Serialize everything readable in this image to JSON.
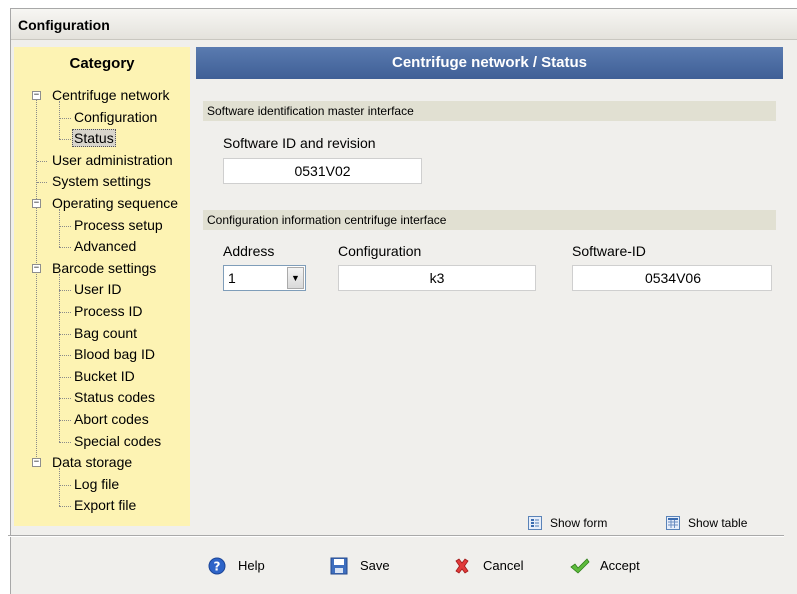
{
  "window": {
    "title": "Configuration"
  },
  "sidebar": {
    "header": "Category",
    "items": [
      {
        "label": "Centrifuge network",
        "level": 0,
        "toggle": "−"
      },
      {
        "label": "Configuration",
        "level": 1
      },
      {
        "label": "Status",
        "level": 1,
        "selected": true
      },
      {
        "label": "User administration",
        "level": 0
      },
      {
        "label": "System settings",
        "level": 0
      },
      {
        "label": "Operating sequence",
        "level": 0,
        "toggle": "−"
      },
      {
        "label": "Process setup",
        "level": 1
      },
      {
        "label": "Advanced",
        "level": 1
      },
      {
        "label": "Barcode settings",
        "level": 0,
        "toggle": "−"
      },
      {
        "label": "User ID",
        "level": 1
      },
      {
        "label": "Process ID",
        "level": 1
      },
      {
        "label": "Bag count",
        "level": 1
      },
      {
        "label": "Blood bag ID",
        "level": 1
      },
      {
        "label": "Bucket ID",
        "level": 1
      },
      {
        "label": "Status codes",
        "level": 1
      },
      {
        "label": "Abort codes",
        "level": 1
      },
      {
        "label": "Special codes",
        "level": 1
      },
      {
        "label": "Data storage",
        "level": 0,
        "toggle": "−"
      },
      {
        "label": "Log file",
        "level": 1
      },
      {
        "label": "Export file",
        "level": 1
      }
    ]
  },
  "main": {
    "header": "Centrifuge network / Status",
    "section1": {
      "title": "Software identification master interface",
      "sw_label": "Software ID and revision",
      "sw_value": "0531V02"
    },
    "section2": {
      "title": "Configuration information centrifuge interface",
      "address_label": "Address",
      "address_value": "1",
      "config_label": "Configuration",
      "config_value": "k3",
      "swid_label": "Software-ID",
      "swid_value": "0534V06"
    },
    "view": {
      "show_form": "Show form",
      "show_table": "Show table"
    }
  },
  "actions": {
    "help": "Help",
    "save": "Save",
    "cancel": "Cancel",
    "accept": "Accept"
  },
  "colors": {
    "sidebar_bg": "#fdf3b3",
    "header_bg": "#4a6aa2",
    "section_bg": "#e1e0d2",
    "window_bg": "#f0efec"
  }
}
